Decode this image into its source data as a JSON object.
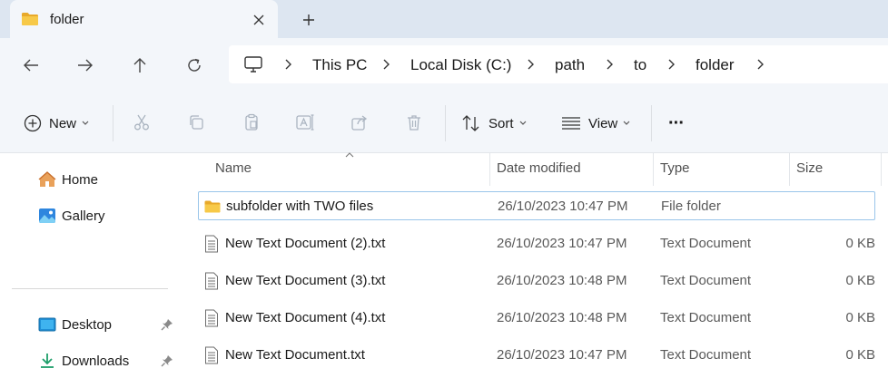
{
  "window": {
    "tab_title": "folder",
    "new_tab_symbol": "+"
  },
  "nav": {
    "breadcrumbs": [
      "This PC",
      "Local Disk (C:)",
      "path",
      "to",
      "folder"
    ]
  },
  "toolbar": {
    "new_label": "New",
    "sort_label": "Sort",
    "view_label": "View",
    "more_label": "···"
  },
  "sidebar": {
    "items": [
      {
        "label": "Home",
        "icon": "home-icon"
      },
      {
        "label": "Gallery",
        "icon": "gallery-icon"
      },
      {
        "label": "Desktop",
        "icon": "desktop-icon",
        "pinned": true
      },
      {
        "label": "Downloads",
        "icon": "downloads-icon",
        "pinned": true
      }
    ]
  },
  "columns": {
    "name": "Name",
    "date": "Date modified",
    "type": "Type",
    "size": "Size"
  },
  "files": [
    {
      "name": "subfolder with TWO files",
      "date": "26/10/2023 10:47 PM",
      "type": "File folder",
      "size": "",
      "icon": "folder-icon",
      "selected": true
    },
    {
      "name": "New Text Document (2).txt",
      "date": "26/10/2023 10:47 PM",
      "type": "Text Document",
      "size": "0 KB",
      "icon": "text-file-icon"
    },
    {
      "name": "New Text Document (3).txt",
      "date": "26/10/2023 10:48 PM",
      "type": "Text Document",
      "size": "0 KB",
      "icon": "text-file-icon"
    },
    {
      "name": "New Text Document (4).txt",
      "date": "26/10/2023 10:48 PM",
      "type": "Text Document",
      "size": "0 KB",
      "icon": "text-file-icon"
    },
    {
      "name": "New Text Document.txt",
      "date": "26/10/2023 10:47 PM",
      "type": "Text Document",
      "size": "0 KB",
      "icon": "text-file-icon"
    }
  ],
  "colors": {
    "tabstrip": "#dde6f1",
    "chrome": "#f3f6fa",
    "selection_border": "#99c5ea",
    "folder": "#f7c948"
  }
}
